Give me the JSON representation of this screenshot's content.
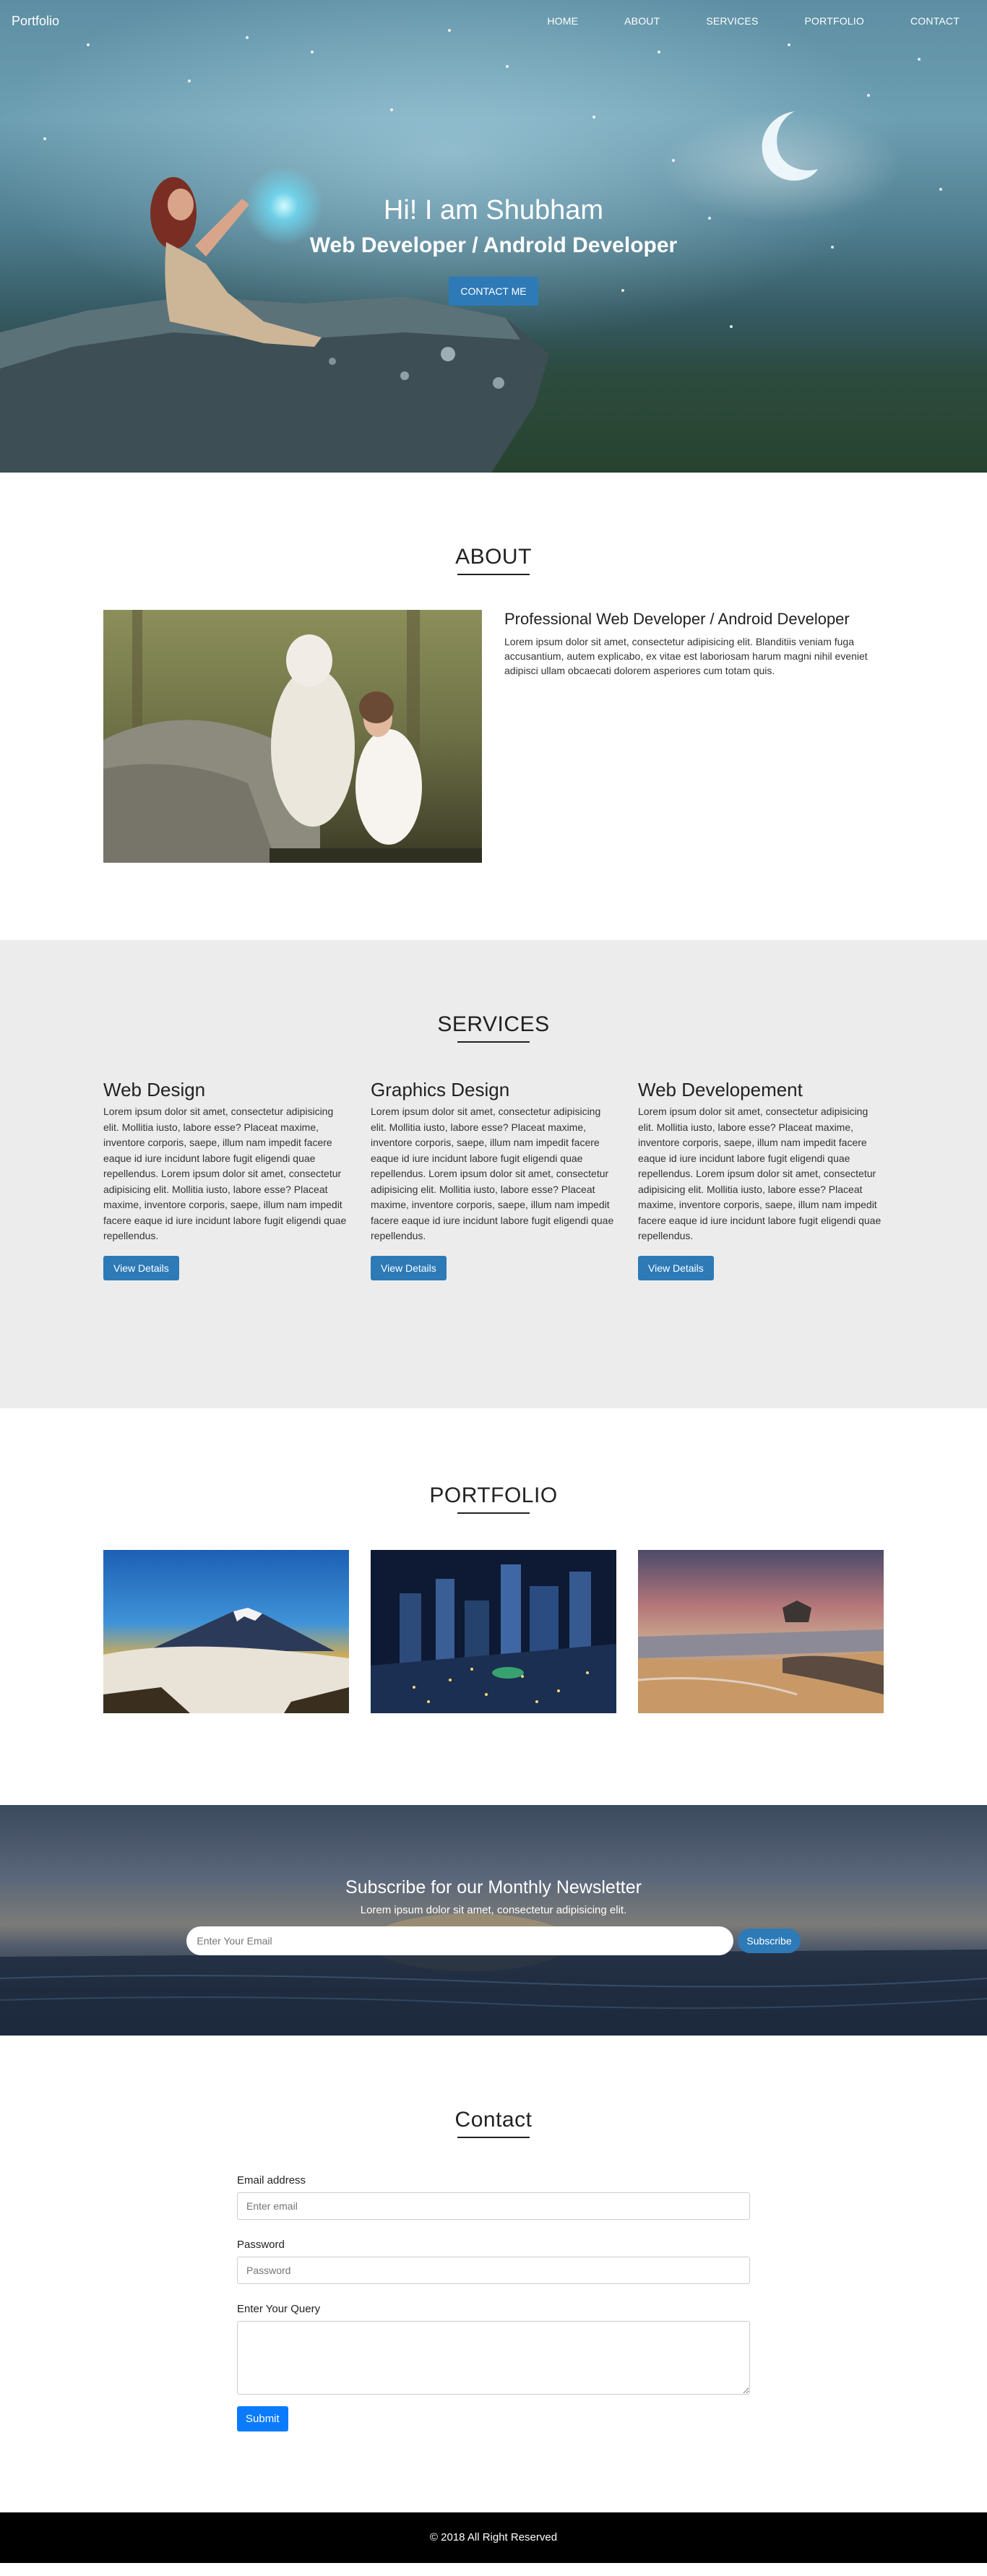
{
  "nav": {
    "brand": "Portfolio",
    "links": [
      "HOME",
      "ABOUT",
      "SERVICES",
      "PORTFOLIO",
      "CONTACT"
    ]
  },
  "hero": {
    "title": "Hi! I am Shubham",
    "subtitle": "Web Developer / Android Developer",
    "button": "CONTACT ME"
  },
  "about": {
    "title": "ABOUT",
    "heading": "Professional Web Developer / Android Developer",
    "text": "Lorem ipsum dolor sit amet, consectetur adipisicing elit. Blanditiis veniam fuga accusantium, autem explicabo, ex vitae est laboriosam harum magni nihil eveniet adipisci ullam obcaecati dolorem asperiores cum totam quis."
  },
  "services": {
    "title": "SERVICES",
    "items": [
      {
        "title": "Web Design",
        "text": "Lorem ipsum dolor sit amet, consectetur adipisicing elit. Mollitia iusto, labore esse? Placeat maxime, inventore corporis, saepe, illum nam impedit facere eaque id iure incidunt labore fugit eligendi quae repellendus. Lorem ipsum dolor sit amet, consectetur adipisicing elit. Mollitia iusto, labore esse? Placeat maxime, inventore corporis, saepe, illum nam impedit facere eaque id iure incidunt labore fugit eligendi quae repellendus.",
        "button": "View Details"
      },
      {
        "title": "Graphics Design",
        "text": "Lorem ipsum dolor sit amet, consectetur adipisicing elit. Mollitia iusto, labore esse? Placeat maxime, inventore corporis, saepe, illum nam impedit facere eaque id iure incidunt labore fugit eligendi quae repellendus. Lorem ipsum dolor sit amet, consectetur adipisicing elit. Mollitia iusto, labore esse? Placeat maxime, inventore corporis, saepe, illum nam impedit facere eaque id iure incidunt labore fugit eligendi quae repellendus.",
        "button": "View Details"
      },
      {
        "title": "Web Developement",
        "text": "Lorem ipsum dolor sit amet, consectetur adipisicing elit. Mollitia iusto, labore esse? Placeat maxime, inventore corporis, saepe, illum nam impedit facere eaque id iure incidunt labore fugit eligendi quae repellendus. Lorem ipsum dolor sit amet, consectetur adipisicing elit. Mollitia iusto, labore esse? Placeat maxime, inventore corporis, saepe, illum nam impedit facere eaque id iure incidunt labore fugit eligendi quae repellendus.",
        "button": "View Details"
      }
    ]
  },
  "portfolio": {
    "title": "PORTFOLIO",
    "images": [
      "mountain-image",
      "city-night-image",
      "beach-image"
    ]
  },
  "newsletter": {
    "title": "Subscribe for our Monthly Newsletter",
    "subtitle": "Lorem ipsum dolor sit amet, consectetur adipisicing elit.",
    "placeholder": "Enter Your Email",
    "button": "Subscribe"
  },
  "contact": {
    "title": "Contact",
    "email_label": "Email address",
    "email_placeholder": "Enter email",
    "password_label": "Password",
    "password_placeholder": "Password",
    "query_label": "Enter Your Query",
    "submit": "Submit"
  },
  "footer": {
    "text": "© 2018 All Right Reserved"
  },
  "colors": {
    "primary_button": "#2d7ab7",
    "submit_button": "#0b7bfe",
    "services_bg": "#ececec",
    "footer_bg": "#000000"
  }
}
